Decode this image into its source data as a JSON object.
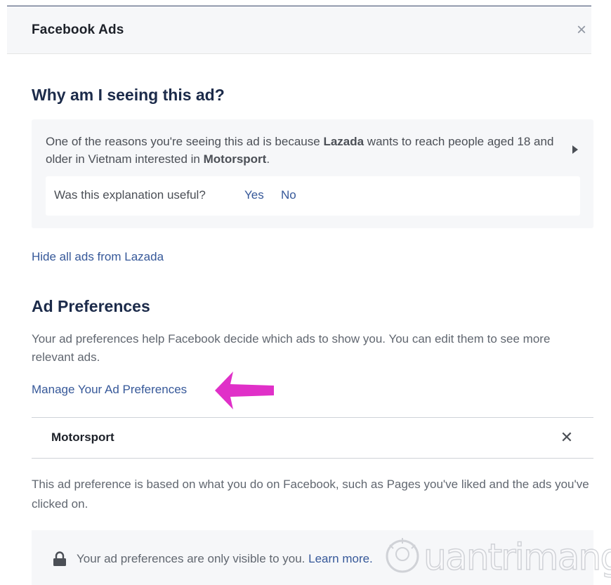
{
  "dialog": {
    "title": "Facebook Ads",
    "close_glyph": "×"
  },
  "why": {
    "title": "Why am I seeing this ad?",
    "reason_part1": "One of the reasons you're seeing this ad is because ",
    "advertiser": "Lazada",
    "reason_part2": " wants to reach people aged 18 and older in Vietnam interested in ",
    "interest": "Motorsport",
    "reason_part3": ".",
    "feedback_question": "Was this explanation useful?",
    "feedback_yes": "Yes",
    "feedback_no": "No"
  },
  "hide_link": "Hide all ads from Lazada",
  "preferences": {
    "title": "Ad Preferences",
    "description": "Your ad preferences help Facebook decide which ads to show you. You can edit them to see more relevant ads.",
    "manage_link": "Manage Your Ad Preferences",
    "interest_item": "Motorsport",
    "remove_glyph": "✕",
    "based_on": "This ad preference is based on what you do on Facebook, such as Pages you've liked and the ads you've clicked on.",
    "privacy_text": "Your ad preferences are only visible to you. ",
    "learn_more": "Learn more."
  },
  "watermark": {
    "text": "uantrimang"
  },
  "icons": {
    "close": "close-icon",
    "caret": "caret-right-icon",
    "remove": "remove-icon",
    "lock": "lock-icon",
    "annotation": "arrow-annotation-icon"
  },
  "colors": {
    "link": "#365899",
    "heading": "#1c2b4a",
    "panel": "#f6f7f9",
    "annotation_arrow": "#e030c8"
  }
}
